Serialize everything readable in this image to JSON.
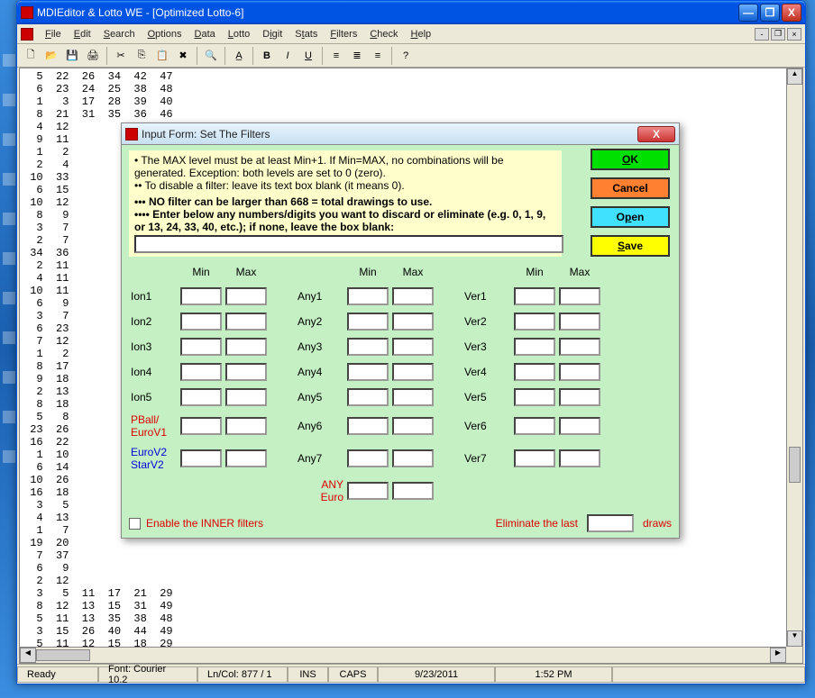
{
  "window": {
    "title": "MDIEditor & Lotto WE - [Optimized Lotto-6]",
    "minimize": "—",
    "maximize": "❐",
    "close": "X"
  },
  "menus": {
    "file": "File",
    "edit": "Edit",
    "search": "Search",
    "options": "Options",
    "data": "Data",
    "lotto": "Lotto",
    "digit": "Digit",
    "stats": "Stats",
    "filters": "Filters",
    "check": "Check",
    "help": "Help"
  },
  "toolbar_icons": [
    "new",
    "open",
    "save",
    "print",
    "sep",
    "cut",
    "copy",
    "paste",
    "delete",
    "sep",
    "find",
    "sep",
    "findnext",
    "sep",
    "bold",
    "italic",
    "underline",
    "sep",
    "left",
    "center",
    "right",
    "sep",
    "help"
  ],
  "content_rows": [
    "  5  22  26  34  42  47",
    "  6  23  24  25  38  48",
    "  1   3  17  28  39  40",
    "  8  21  31  35  36  46",
    "  4  12",
    "  9  11",
    "  1   2",
    "  2   4",
    " 10  33",
    "  6  15",
    " 10  12",
    "  8   9",
    "  3   7",
    "  2   7",
    " 34  36",
    "  2  11",
    "  4  11",
    " 10  11",
    "  6   9",
    "  3   7",
    "  6  23",
    "  7  12",
    "  1   2",
    "  8  17",
    "  9  18",
    "  2  13",
    "  8  18",
    "  5   8",
    " 23  26",
    " 16  22",
    "  1  10",
    "  6  14",
    " 10  26",
    " 16  18",
    "  3   5",
    "  4  13",
    "  1   7",
    " 19  20",
    "  7  37",
    "  6   9",
    "  2  12",
    "  3   5  11  17  21  29",
    "  8  12  13  15  31  49",
    "  5  11  13  35  38  48",
    "  3  15  26  40  44  49",
    "  5  11  12  15  18  29"
  ],
  "statusbar": {
    "ready": "Ready",
    "font": "Font: Courier 10.2",
    "lncol": "Ln/Col: 877 / 1",
    "ins": "INS",
    "caps": "CAPS",
    "date": "9/23/2011",
    "time": "1:52 PM"
  },
  "dialog": {
    "title": "Input Form: Set The Filters",
    "close": "X",
    "info_l1": "• The MAX level must be at least Min+1. If Min=MAX, no combinations will be generated.  Exception: both levels are set to 0 (zero).",
    "info_l2": "•• To disable a filter: leave its text box blank (it means 0).",
    "info_l3": "••• NO filter can be larger than 668 = total drawings to use.",
    "info_l4": "•••• Enter below any numbers/digits you want to discard or eliminate  (e.g.  0, 1, 9, or 13, 24, 33, 40, etc.);  if none, leave the box blank:",
    "discard_value": "",
    "btn_ok": "OK",
    "btn_cancel": "Cancel",
    "btn_open": "Open",
    "btn_save": "Save",
    "col_min": "Min",
    "col_max": "Max",
    "rows_ion": [
      "Ion1",
      "Ion2",
      "Ion3",
      "Ion4",
      "Ion5"
    ],
    "rows_any": [
      "Any1",
      "Any2",
      "Any3",
      "Any4",
      "Any5",
      "Any6",
      "Any7"
    ],
    "rows_ver": [
      "Ver1",
      "Ver2",
      "Ver3",
      "Ver4",
      "Ver5",
      "Ver6",
      "Ver7"
    ],
    "lbl_pball1": "PBall/",
    "lbl_pball2": "EuroV1",
    "lbl_eurov2a": "EuroV2",
    "lbl_eurov2b": "StarV2",
    "lbl_anyeuro1": "ANY",
    "lbl_anyeuro2": "Euro",
    "chk_label": "Enable the INNER filters",
    "elim_label": "Eliminate the last",
    "elim_value": "",
    "elim_draws": "draws"
  }
}
